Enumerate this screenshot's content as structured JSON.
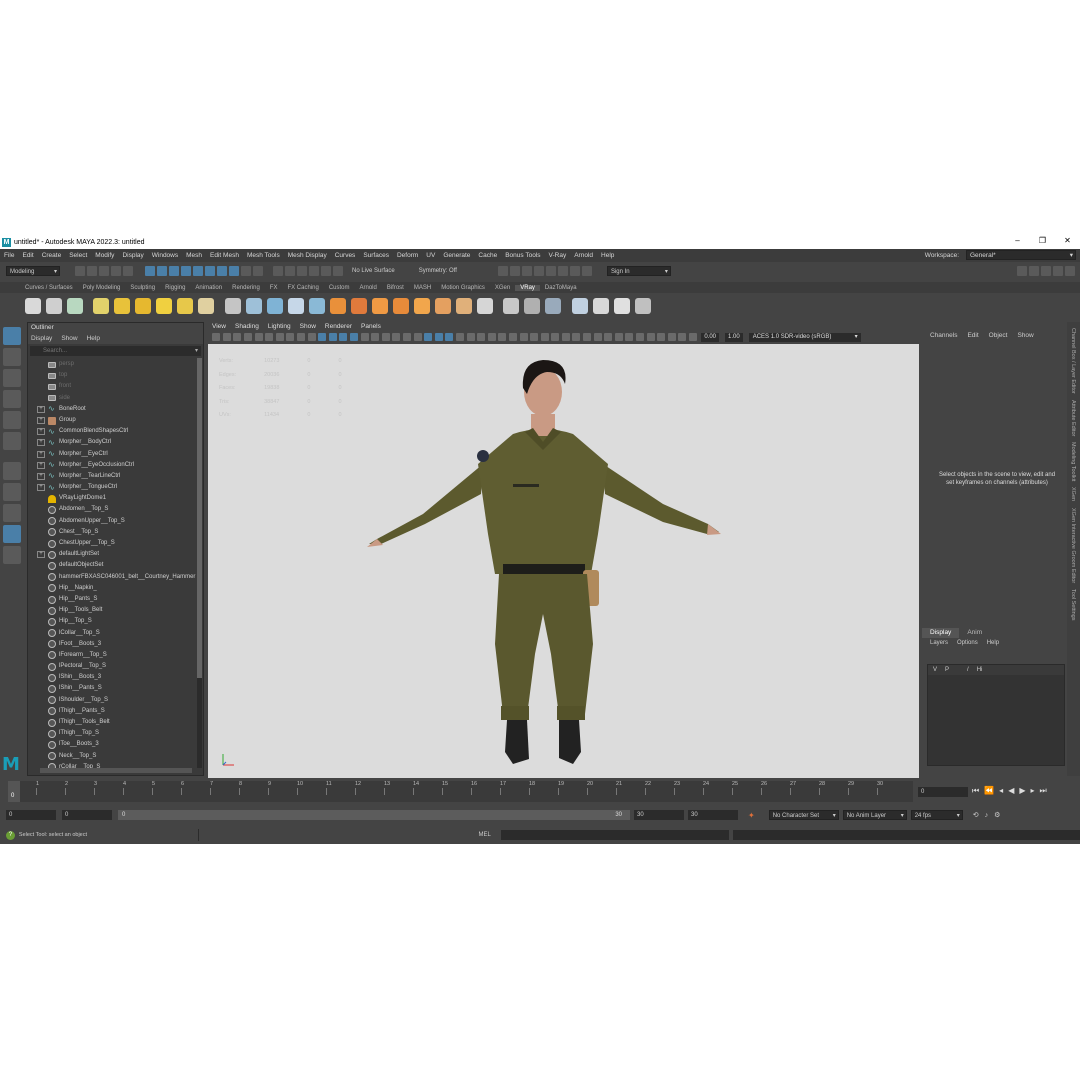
{
  "titlebar": {
    "title": "untitled* - Autodesk MAYA 2022.3: untitled",
    "logo": "M",
    "min": "–",
    "max": "❐",
    "close": "✕"
  },
  "menubar": {
    "items": [
      "File",
      "Edit",
      "Create",
      "Select",
      "Modify",
      "Display",
      "Windows",
      "Mesh",
      "Edit Mesh",
      "Mesh Tools",
      "Mesh Display",
      "Curves",
      "Surfaces",
      "Deform",
      "UV",
      "Generate",
      "Cache",
      "Bonus Tools",
      "V-Ray",
      "Arnold",
      "Help"
    ],
    "workspace_label": "Workspace:",
    "workspace_value": "General*"
  },
  "statusline": {
    "mode": "Modeling",
    "live_surface": "No Live Surface",
    "symmetry": "Symmetry: Off",
    "sign_in": "Sign In"
  },
  "shelf": {
    "tabs": [
      "Curves / Surfaces",
      "Poly Modeling",
      "Sculpting",
      "Rigging",
      "Animation",
      "Rendering",
      "FX",
      "FX Caching",
      "Custom",
      "Arnold",
      "Bifrost",
      "MASH",
      "Motion Graphics",
      "XGen",
      "VRay",
      "DazToMaya"
    ],
    "active_tab": "VRay",
    "icon_colors": [
      "#d9d9d9",
      "#cfcfcf",
      "#b8d8c0",
      "#e2d26b",
      "#e8c23a",
      "#e6b82f",
      "#f0d040",
      "#e7c84a",
      "#e0d0a0",
      "#c5c5c5",
      "#9ec0d8",
      "#7fb3d5",
      "#c6d7e8",
      "#8ab9d6",
      "#e9903a",
      "#e07a3c",
      "#f09a44",
      "#e88b3a",
      "#f1a64c",
      "#e4a060",
      "#e0b07a",
      "#d6d6d6",
      "#c8c8c8",
      "#b0b0b0",
      "#9ab",
      "#c0d0e0",
      "#d8d8d8",
      "#e0e0e0",
      "#c0c0c0"
    ]
  },
  "outliner": {
    "title": "Outliner",
    "menu": [
      "Display",
      "Show",
      "Help"
    ],
    "search_placeholder": "Search...",
    "items": [
      {
        "label": "persp",
        "icon": "cam",
        "dim": true,
        "exp": false
      },
      {
        "label": "top",
        "icon": "cam",
        "dim": true,
        "exp": false
      },
      {
        "label": "front",
        "icon": "cam",
        "dim": true,
        "exp": false
      },
      {
        "label": "side",
        "icon": "cam",
        "dim": true,
        "exp": false
      },
      {
        "label": "BoneRoot",
        "icon": "curve",
        "dim": false,
        "exp": true
      },
      {
        "label": "Group",
        "icon": "group",
        "dim": false,
        "exp": true
      },
      {
        "label": "CommonBlendShapesCtrl",
        "icon": "curve",
        "dim": false,
        "exp": true
      },
      {
        "label": "Morpher__BodyCtrl",
        "icon": "curve",
        "dim": false,
        "exp": true
      },
      {
        "label": "Morpher__EyeCtrl",
        "icon": "curve",
        "dim": false,
        "exp": true
      },
      {
        "label": "Morpher__EyeOcclusionCtrl",
        "icon": "curve",
        "dim": false,
        "exp": true
      },
      {
        "label": "Morpher__TearLineCtrl",
        "icon": "curve",
        "dim": false,
        "exp": true
      },
      {
        "label": "Morpher__TongueCtrl",
        "icon": "curve",
        "dim": false,
        "exp": true
      },
      {
        "label": "VRayLightDome1",
        "icon": "light",
        "dim": false,
        "exp": false
      },
      {
        "label": "Abdomen__Top_S",
        "icon": "set",
        "dim": false,
        "exp": false
      },
      {
        "label": "AbdomenUpper__Top_S",
        "icon": "set",
        "dim": false,
        "exp": false
      },
      {
        "label": "Chest__Top_S",
        "icon": "set",
        "dim": false,
        "exp": false
      },
      {
        "label": "ChestUpper__Top_S",
        "icon": "set",
        "dim": false,
        "exp": false
      },
      {
        "label": "defaultLightSet",
        "icon": "set",
        "dim": false,
        "exp": true
      },
      {
        "label": "defaultObjectSet",
        "icon": "set",
        "dim": false,
        "exp": false
      },
      {
        "label": "hammerFBXASC046001_belt__Courtney_Hammer",
        "icon": "set",
        "dim": false,
        "exp": false
      },
      {
        "label": "Hip__Napkin_",
        "icon": "set",
        "dim": false,
        "exp": false
      },
      {
        "label": "Hip__Pants_S",
        "icon": "set",
        "dim": false,
        "exp": false
      },
      {
        "label": "Hip__Tools_Belt",
        "icon": "set",
        "dim": false,
        "exp": false
      },
      {
        "label": "Hip__Top_S",
        "icon": "set",
        "dim": false,
        "exp": false
      },
      {
        "label": "lCollar__Top_S",
        "icon": "set",
        "dim": false,
        "exp": false
      },
      {
        "label": "lFoot__Boots_3",
        "icon": "set",
        "dim": false,
        "exp": false
      },
      {
        "label": "lForearm__Top_S",
        "icon": "set",
        "dim": false,
        "exp": false
      },
      {
        "label": "lPectoral__Top_S",
        "icon": "set",
        "dim": false,
        "exp": false
      },
      {
        "label": "lShin__Boots_3",
        "icon": "set",
        "dim": false,
        "exp": false
      },
      {
        "label": "lShin__Pants_S",
        "icon": "set",
        "dim": false,
        "exp": false
      },
      {
        "label": "lShoulder__Top_S",
        "icon": "set",
        "dim": false,
        "exp": false
      },
      {
        "label": "lThigh__Pants_S",
        "icon": "set",
        "dim": false,
        "exp": false
      },
      {
        "label": "lThigh__Tools_Belt",
        "icon": "set",
        "dim": false,
        "exp": false
      },
      {
        "label": "lThigh__Top_S",
        "icon": "set",
        "dim": false,
        "exp": false
      },
      {
        "label": "lToe__Boots_3",
        "icon": "set",
        "dim": false,
        "exp": false
      },
      {
        "label": "Neck__Top_S",
        "icon": "set",
        "dim": false,
        "exp": false
      },
      {
        "label": "rCollar__Top_S",
        "icon": "set",
        "dim": false,
        "exp": false
      }
    ]
  },
  "viewport": {
    "menu": [
      "View",
      "Shading",
      "Lighting",
      "Show",
      "Renderer",
      "Panels"
    ],
    "exposure": "0.00",
    "gamma": "1.00",
    "colorspace": "ACES 1.0 SDR-video (sRGB)",
    "hud": [
      [
        "Verts:",
        "10273",
        "0",
        "0"
      ],
      [
        "Edges:",
        "20036",
        "0",
        "0"
      ],
      [
        "Faces:",
        "19838",
        "0",
        "0"
      ],
      [
        "Tris:",
        "38847",
        "0",
        "0"
      ],
      [
        "UVs:",
        "11434",
        "0",
        "0"
      ]
    ]
  },
  "channelbox": {
    "menu": [
      "Channels",
      "Edit",
      "Object",
      "Show"
    ],
    "empty_message": "Select objects in the scene to view, edit and set keyframes on channels (attributes)",
    "layer_tabs": [
      "Display",
      "Anim"
    ],
    "layer_menu": [
      "Layers",
      "Options",
      "Help"
    ],
    "layer_cols": [
      "V",
      "P",
      "/",
      "Hi"
    ]
  },
  "sidetabs": [
    "Channel Box / Layer Editor",
    "Attribute Editor",
    "Modeling Toolkit",
    "XGen",
    "XGen Interactive Groom Editor",
    "Tool Settings"
  ],
  "timeline": {
    "ticks": [
      "1",
      "2",
      "3",
      "4",
      "5",
      "6",
      "7",
      "8",
      "9",
      "10",
      "11",
      "12",
      "13",
      "14",
      "15",
      "16",
      "17",
      "18",
      "19",
      "20",
      "21",
      "22",
      "23",
      "24",
      "25",
      "26",
      "27",
      "28",
      "29",
      "30"
    ],
    "current": "0",
    "frame_field": "0"
  },
  "range": {
    "start": "0",
    "start2": "0",
    "slider_left": "0",
    "slider_right": "30",
    "end": "30",
    "end2": "30",
    "char_set": "No Character Set",
    "anim_layer": "No Anim Layer",
    "fps": "24 fps"
  },
  "helpline": {
    "message": "Select Tool: select an object",
    "mel": "MEL"
  },
  "colors": {
    "accent": "#4a7fa8",
    "maya_teal": "#1a9eb8",
    "uniform": "#5c5a2e"
  }
}
